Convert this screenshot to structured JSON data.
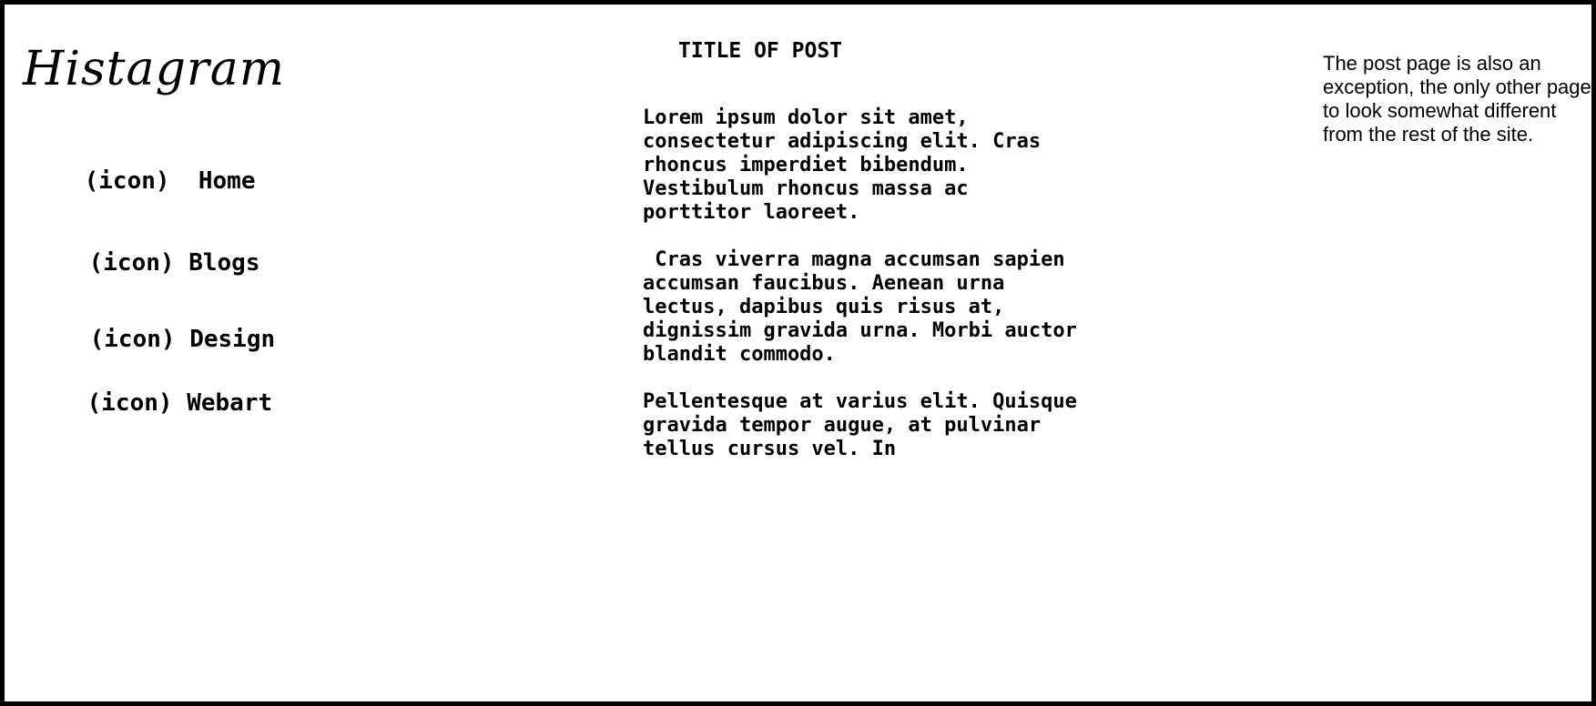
{
  "brand": {
    "logo_text": "Histagram"
  },
  "nav": {
    "items": [
      {
        "icon_label": "(icon)",
        "label": "Home"
      },
      {
        "icon_label": "(icon)",
        "label": "Blogs"
      },
      {
        "icon_label": "(icon)",
        "label": "Design"
      },
      {
        "icon_label": "(icon)",
        "label": "Webart"
      }
    ]
  },
  "post": {
    "title": "TITLE OF POST",
    "paragraphs": [
      "Lorem ipsum dolor sit amet,\nconsectetur adipiscing elit. Cras\nrhoncus imperdiet bibendum.\nVestibulum rhoncus massa ac\nporttitor laoreet.",
      " Cras viverra magna accumsan sapien\naccumsan faucibus. Aenean urna\nlectus, dapibus quis risus at,\ndignissim gravida urna. Morbi auctor\nblandit commodo.",
      "Pellentesque at varius elit. Quisque\ngravida tempor augue, at pulvinar\ntellus cursus vel. In"
    ]
  },
  "sidebar_note": {
    "text": "The post page is also an exception, the only other page to look somewhat different from the rest of the site."
  }
}
